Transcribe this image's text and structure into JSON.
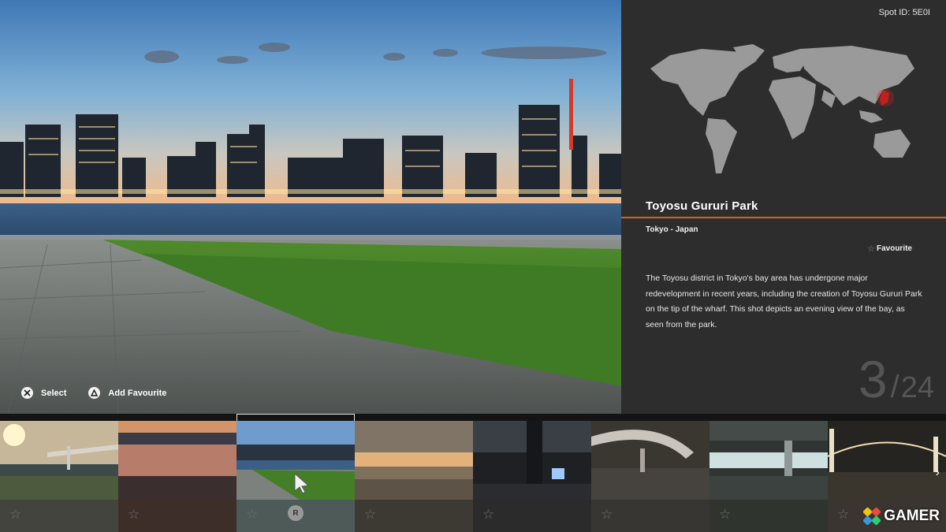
{
  "hero": {
    "image": "evening-bay-view-tokyo-skyline"
  },
  "prompts": [
    {
      "icon": "cross-button-icon",
      "label": "Select"
    },
    {
      "icon": "triangle-button-icon",
      "label": "Add Favourite"
    }
  ],
  "panel": {
    "spot_id": "Spot ID: 5E0I",
    "place_name": "Toyosu Gururi Park",
    "location": "Tokyo - Japan",
    "favourite_label": "Favourite",
    "description": "The Toyosu district in Tokyo's bay area has undergone major redevelopment in recent years, including the creation of Toyosu Gururi Park on the tip of the wharf. This shot depicts an evening view of the bay, as seen from the park.",
    "counter": {
      "current": "3",
      "separator": "/",
      "total": "24"
    },
    "accent_color": "#d0641f",
    "map_highlight_color": "#c02020"
  },
  "strip": {
    "selected_index": 2,
    "thumbnails": [
      {
        "scene": "sunset-bridge-shore",
        "favourite": false
      },
      {
        "scene": "dusk-waterfront-skyline",
        "favourite": false
      },
      {
        "scene": "evening-bay-view-tokyo-skyline",
        "favourite": false
      },
      {
        "scene": "cloudy-sunset-pier",
        "favourite": false
      },
      {
        "scene": "night-industrial-tower",
        "favourite": false
      },
      {
        "scene": "elevated-highway-curve",
        "favourite": false
      },
      {
        "scene": "underpass-parking",
        "favourite": false
      },
      {
        "scene": "rainbow-bridge-night",
        "favourite": false
      }
    ],
    "r_button_label": "R",
    "next_icon": "chevron-right-icon"
  },
  "watermark": {
    "text": "GAMER"
  }
}
